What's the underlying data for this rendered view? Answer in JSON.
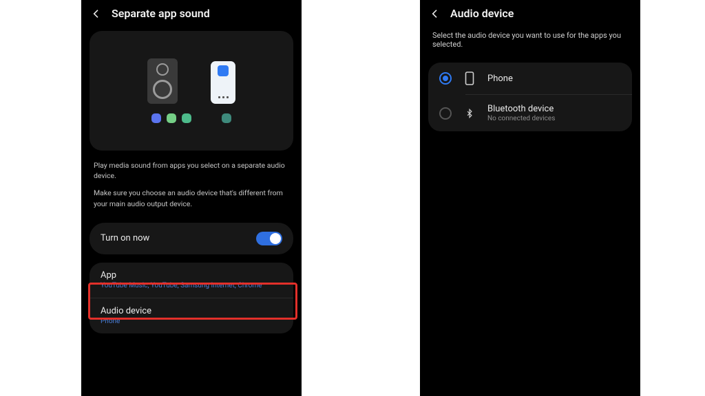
{
  "left": {
    "title": "Separate app sound",
    "desc1": "Play media sound from apps you select on a separate audio device.",
    "desc2": "Make sure you choose an audio device that's different from your main audio output device.",
    "toggle_label": "Turn on now",
    "toggle_on": true,
    "app_row": {
      "title": "App",
      "value": "YouTube Music, YouTube, Samsung Internet, Chrome"
    },
    "device_row": {
      "title": "Audio device",
      "value": "Phone"
    }
  },
  "right": {
    "title": "Audio device",
    "subtext": "Select the audio device you want to use for the apps you selected.",
    "options": [
      {
        "label": "Phone",
        "sub": "",
        "selected": true,
        "icon": "phone"
      },
      {
        "label": "Bluetooth device",
        "sub": "No connected devices",
        "selected": false,
        "icon": "bluetooth"
      }
    ]
  }
}
